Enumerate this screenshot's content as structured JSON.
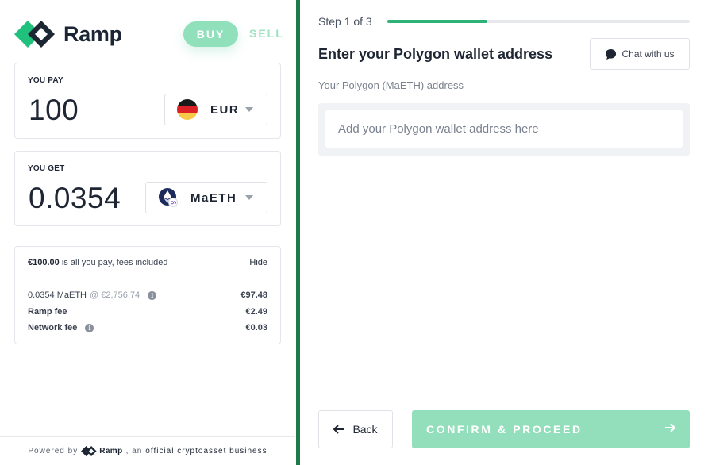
{
  "brand": {
    "name": "Ramp"
  },
  "tabs": {
    "buy": "BUY",
    "sell": "SELL"
  },
  "pay": {
    "label": "YOU PAY",
    "amount": "100",
    "currency": "EUR"
  },
  "get": {
    "label": "YOU GET",
    "amount": "0.0354",
    "currency": "MaETH"
  },
  "fees": {
    "total": "€100.00",
    "total_suffix": " is all you pay, fees included",
    "hide": "Hide",
    "rows": [
      {
        "label": "0.0354 MaETH",
        "rate": " @ €2,756.74",
        "value": "€97.48"
      },
      {
        "label": "Ramp fee",
        "value": "€2.49"
      },
      {
        "label": "Network fee",
        "value": "€0.03"
      }
    ]
  },
  "footer": {
    "prefix": "Powered by",
    "brand": "Ramp",
    "middle": ", an",
    "suffix": "official cryptoasset business"
  },
  "step": {
    "text": "Step 1 of 3",
    "progress": 0.33
  },
  "main": {
    "heading": "Enter your Polygon wallet address",
    "chat": "Chat with us",
    "field_label": "Your Polygon (MaETH) address",
    "placeholder": "Add your Polygon wallet address here",
    "value": ""
  },
  "actions": {
    "back": "Back",
    "confirm": "CONFIRM & PROCEED"
  },
  "colors": {
    "accent": "#2fb276",
    "divider": "#1e7a4b",
    "button_disabled": "#93dfbb"
  },
  "icons": {
    "flag": "germany-flag-icon",
    "coin": "polygon-eth-icon"
  }
}
